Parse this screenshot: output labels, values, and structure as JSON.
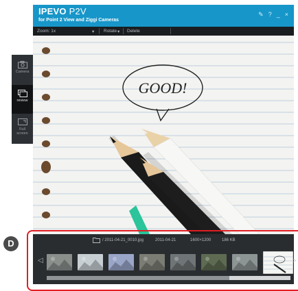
{
  "app": {
    "brand_bold": "IPEVO",
    "brand_name": "P2V",
    "subtitle": "for Point 2 View and Ziggi Cameras",
    "window_controls": {
      "settings": "✎",
      "help": "?",
      "minimize": "_",
      "close": "×"
    }
  },
  "toolbar": {
    "zoom_label": "Zoom: 1x",
    "rotate_label": "Rotate",
    "delete_label": "Delete",
    "dropdown_arrow": "▾"
  },
  "sidebar": {
    "items": [
      {
        "label": "Camera",
        "icon": "camera-icon",
        "active": false
      },
      {
        "label": "review",
        "icon": "review-icon",
        "active": true
      },
      {
        "label": "Full screen",
        "icon": "fullscreen-icon",
        "active": false
      }
    ]
  },
  "viewport": {
    "speech_text": "GOOD!"
  },
  "filmstrip": {
    "folder_icon": "folder-icon",
    "path": "/ 2011-04-21_0010.jpg",
    "date": "2011-04-21",
    "resolution": "1600×1200",
    "size": "186 KB",
    "prev_arrow": "◁",
    "next_arrow": "▷",
    "thumbnails": [
      {
        "name": "thumb-1",
        "color": "#8a8f8c",
        "selected": false
      },
      {
        "name": "thumb-2",
        "color": "#c7cfd3",
        "selected": false
      },
      {
        "name": "thumb-3",
        "color": "#9aa6c8",
        "selected": false
      },
      {
        "name": "thumb-4",
        "color": "#7b7d74",
        "selected": false
      },
      {
        "name": "thumb-5",
        "color": "#6f7576",
        "selected": false
      },
      {
        "name": "thumb-6",
        "color": "#5e6b52",
        "selected": false
      },
      {
        "name": "thumb-7",
        "color": "#8c9494",
        "selected": false
      },
      {
        "name": "thumb-8",
        "color": "#f5f5f3",
        "selected": true
      }
    ],
    "scroll_fraction_start": 0.75
  },
  "annotation": {
    "badge": "D",
    "highlight_color": "#e21d23"
  },
  "colors": {
    "titlebar": "#1796c9",
    "chrome_dark": "#2b2f33"
  }
}
